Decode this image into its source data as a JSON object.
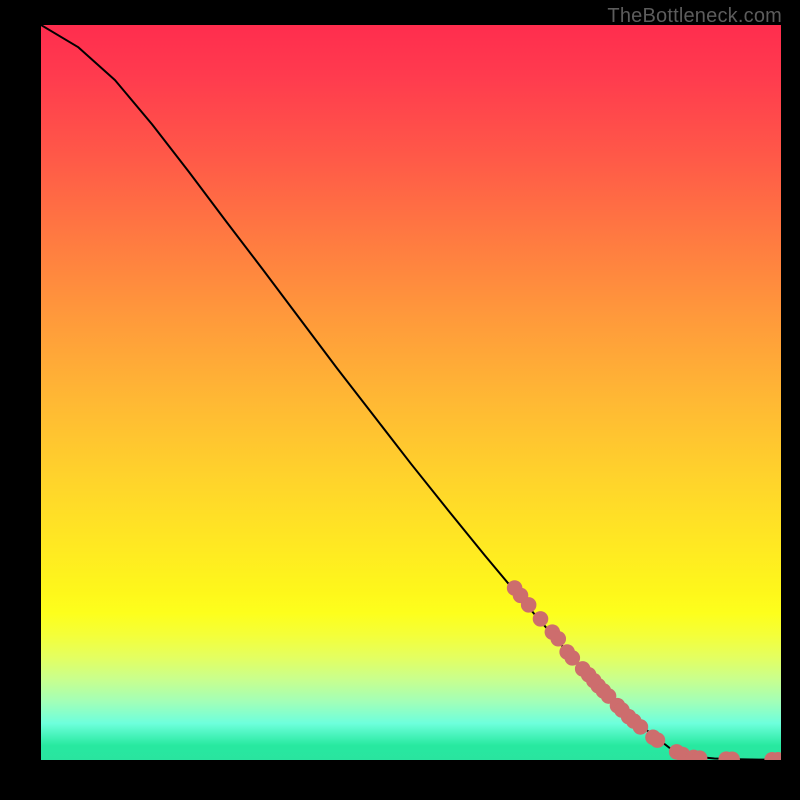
{
  "watermark": "TheBottleneck.com",
  "chart_data": {
    "type": "line",
    "title": "",
    "xlabel": "",
    "ylabel": "",
    "xlim": [
      0,
      100
    ],
    "ylim": [
      0,
      100
    ],
    "grid": false,
    "series": [
      {
        "name": "curve",
        "color": "#000000",
        "x": [
          0,
          5,
          10,
          15,
          20,
          25,
          30,
          35,
          40,
          45,
          50,
          55,
          60,
          65,
          70,
          75,
          80,
          85,
          88,
          91,
          94,
          97,
          100
        ],
        "y": [
          100,
          97,
          92.5,
          86.5,
          80,
          73.3,
          66.7,
          60,
          53.3,
          46.8,
          40.3,
          34,
          27.8,
          21.8,
          16,
          10.5,
          5.5,
          1.6,
          0.5,
          0.2,
          0.1,
          0.05,
          0.03
        ]
      }
    ],
    "markers": {
      "name": "dots",
      "color": "#cd6d6d",
      "radius_pct": 1.05,
      "points": [
        {
          "x": 64.0,
          "y": 23.4
        },
        {
          "x": 64.8,
          "y": 22.4
        },
        {
          "x": 65.9,
          "y": 21.1
        },
        {
          "x": 67.5,
          "y": 19.2
        },
        {
          "x": 69.1,
          "y": 17.4
        },
        {
          "x": 69.9,
          "y": 16.5
        },
        {
          "x": 71.1,
          "y": 14.7
        },
        {
          "x": 71.8,
          "y": 13.9
        },
        {
          "x": 73.2,
          "y": 12.4
        },
        {
          "x": 74.0,
          "y": 11.6
        },
        {
          "x": 74.7,
          "y": 10.8
        },
        {
          "x": 75.3,
          "y": 10.1
        },
        {
          "x": 76.0,
          "y": 9.4
        },
        {
          "x": 76.7,
          "y": 8.7
        },
        {
          "x": 77.9,
          "y": 7.4
        },
        {
          "x": 78.5,
          "y": 6.8
        },
        {
          "x": 79.4,
          "y": 5.9
        },
        {
          "x": 80.1,
          "y": 5.3
        },
        {
          "x": 81.0,
          "y": 4.5
        },
        {
          "x": 82.7,
          "y": 3.1
        },
        {
          "x": 83.3,
          "y": 2.7
        },
        {
          "x": 85.9,
          "y": 1.1
        },
        {
          "x": 86.7,
          "y": 0.75
        },
        {
          "x": 88.2,
          "y": 0.35
        },
        {
          "x": 89.0,
          "y": 0.25
        },
        {
          "x": 92.6,
          "y": 0.12
        },
        {
          "x": 93.4,
          "y": 0.1
        },
        {
          "x": 98.8,
          "y": 0.04
        },
        {
          "x": 99.6,
          "y": 0.03
        }
      ]
    }
  }
}
